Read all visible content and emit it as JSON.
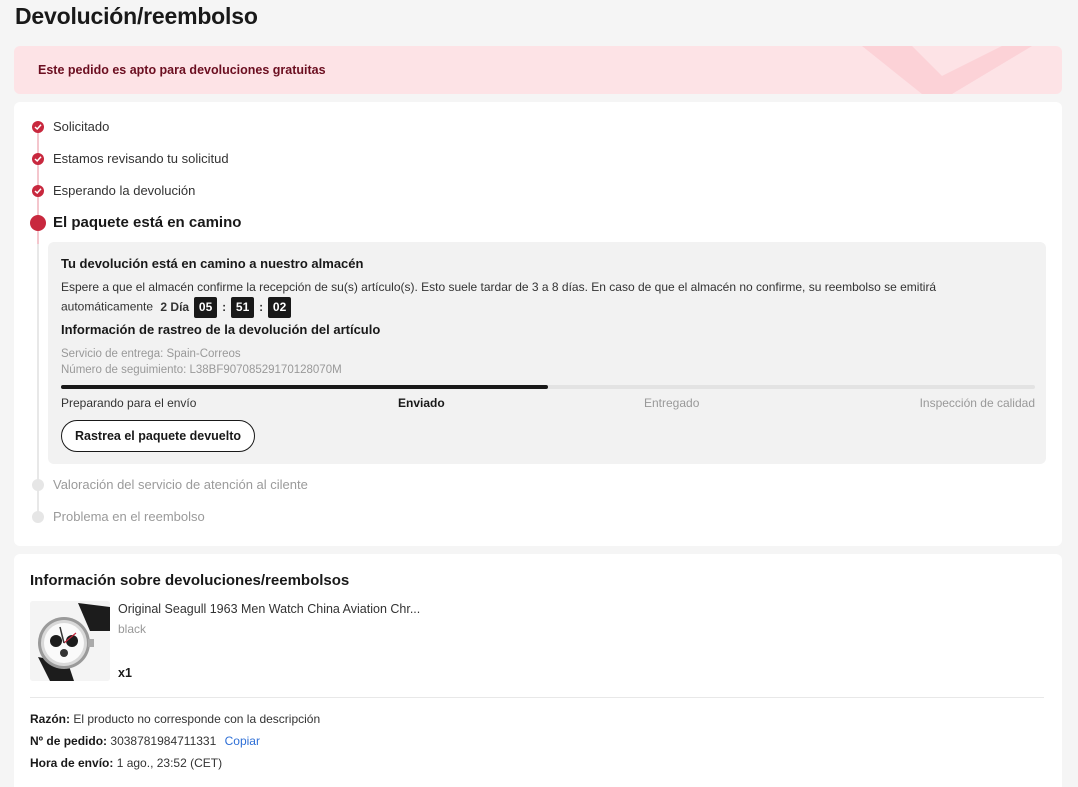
{
  "page": {
    "title": "Devolución/reembolso"
  },
  "banner": {
    "text": "Este pedido es apto para devoluciones gratuitas"
  },
  "steps": [
    {
      "label": "Solicitado",
      "state": "done"
    },
    {
      "label": "Estamos revisando tu solicitud",
      "state": "done"
    },
    {
      "label": "Esperando la devolución",
      "state": "done"
    },
    {
      "label": "El paquete está en camino",
      "state": "current"
    },
    {
      "label": "Valoración del servicio de atención al cilente",
      "state": "pending"
    },
    {
      "label": "Problema en el reembolso",
      "state": "pending"
    }
  ],
  "detail": {
    "title": "Tu devolución está en camino a nuestro almacén",
    "text_line1": "Espere a que el almacén confirme la recepción de su(s) artículo(s). Esto suele tardar de 3 a 8 días. En caso de que el almacén no confirme, su reembolso se emitirá",
    "text_line2": "automáticamente",
    "countdown": {
      "days": "2 Día",
      "hours": "05",
      "minutes": "51",
      "seconds": "02"
    },
    "tracking_title": "Información de rastreo de la devolución del artículo",
    "delivery_service": "Servicio de entrega: Spain-Correos",
    "tracking_number": "Número de seguimiento: L38BF90708529170128070M",
    "progress_fraction": 0.5,
    "stages": [
      "Preparando para el envío",
      "Enviado",
      "Entregado",
      "Inspección de calidad"
    ],
    "track_button": "Rastrea el paquete devuelto"
  },
  "info": {
    "title": "Información sobre devoluciones/reembolsos",
    "product": {
      "name": "Original Seagull 1963 Men Watch China Aviation Chr...",
      "variant": "black",
      "quantity": "x1"
    },
    "reason_label": "Razón:",
    "reason_value": "El producto no corresponde con la descripción",
    "order_label": "Nº de pedido:",
    "order_value": "3038781984711331",
    "copy_label": "Copiar",
    "ship_label": "Hora de envío:",
    "ship_value": "1 ago., 23:52 (CET)"
  },
  "colors": {
    "accent": "#c8283e",
    "banner_bg": "#fde3e6",
    "link": "#2e6fd6"
  }
}
